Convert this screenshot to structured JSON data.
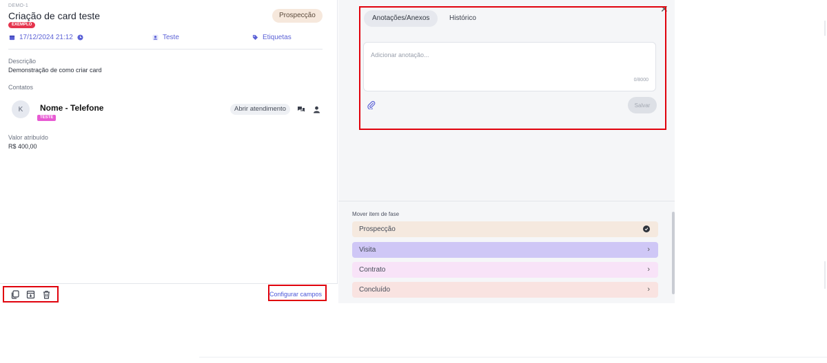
{
  "card": {
    "id": "DEMO-1",
    "title": "Criação de card teste",
    "badge": "EXEMPLO",
    "stage": "Prospecção",
    "date": "17/12/2024 21:12",
    "user": "Teste",
    "tags": "Etiquetas"
  },
  "details": {
    "description_label": "Descrição",
    "description_value": "Demonstração de como criar card",
    "contacts_label": "Contatos",
    "contact": {
      "initial": "K",
      "name": "Nome - Telefone",
      "badge": "TESTE",
      "action": "Abrir atendimento"
    },
    "value_label": "Valor atribuído",
    "value": "R$ 400,00"
  },
  "footer": {
    "config_link": "Configurar campos"
  },
  "notes": {
    "tabs": [
      "Anotações/Anexos",
      "Histórico"
    ],
    "placeholder": "Adicionar anotação...",
    "counter": "0/8000",
    "save_label": "Salvar"
  },
  "phases": {
    "label": "Mover item de fase",
    "items": [
      {
        "label": "Prospecção",
        "color": "#f5e9df",
        "current": true
      },
      {
        "label": "Visita",
        "color": "#cfc7f6",
        "current": false
      },
      {
        "label": "Contrato",
        "color": "#f8e3f8",
        "current": false
      },
      {
        "label": "Concluído",
        "color": "#f9e3e1",
        "current": false
      }
    ]
  },
  "colors": {
    "accent": "#5b61d6",
    "highlight": "#e0000b"
  },
  "icons": [
    "calendar-icon",
    "clock-icon",
    "user-icon",
    "tag-icon",
    "chat-icon",
    "person-icon",
    "copy-icon",
    "archive-icon",
    "trash-icon",
    "close-icon",
    "paperclip-icon",
    "check-circle-icon",
    "chevron-right-icon"
  ]
}
